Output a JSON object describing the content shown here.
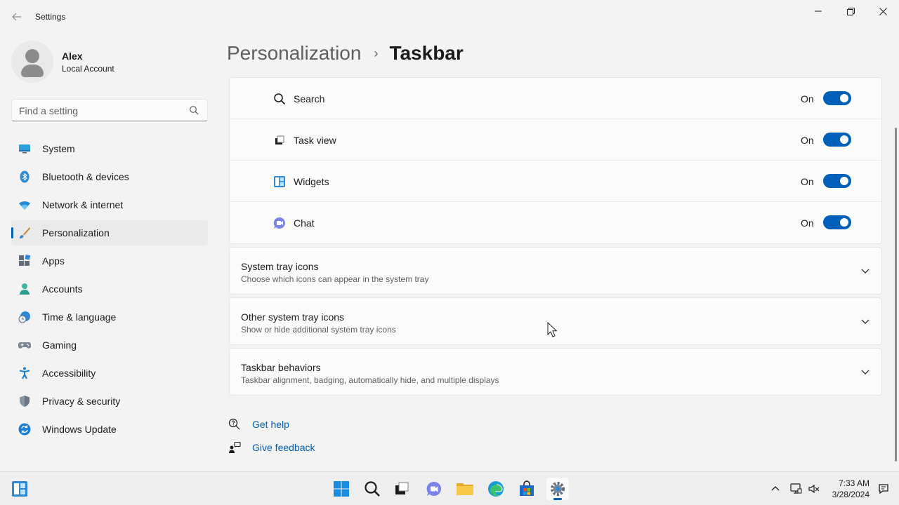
{
  "window": {
    "title": "Settings",
    "controls": {
      "minimize": "—",
      "maximize": "▢",
      "close": "✕"
    }
  },
  "profile": {
    "name": "Alex",
    "account_type": "Local Account"
  },
  "search": {
    "placeholder": "Find a setting",
    "value": ""
  },
  "sidebar": {
    "items": [
      {
        "label": "System",
        "icon": "system-icon",
        "active": false
      },
      {
        "label": "Bluetooth & devices",
        "icon": "bluetooth-icon",
        "active": false
      },
      {
        "label": "Network & internet",
        "icon": "wifi-icon",
        "active": false
      },
      {
        "label": "Personalization",
        "icon": "brush-icon",
        "active": true
      },
      {
        "label": "Apps",
        "icon": "apps-icon",
        "active": false
      },
      {
        "label": "Accounts",
        "icon": "accounts-icon",
        "active": false
      },
      {
        "label": "Time & language",
        "icon": "clock-globe-icon",
        "active": false
      },
      {
        "label": "Gaming",
        "icon": "gamepad-icon",
        "active": false
      },
      {
        "label": "Accessibility",
        "icon": "accessibility-icon",
        "active": false
      },
      {
        "label": "Privacy & security",
        "icon": "shield-icon",
        "active": false
      },
      {
        "label": "Windows Update",
        "icon": "update-icon",
        "active": false
      }
    ]
  },
  "breadcrumb": {
    "parent": "Personalization",
    "separator": "›",
    "current": "Taskbar"
  },
  "taskbar_items": {
    "rows": [
      {
        "label": "Search",
        "state": "On",
        "icon": "search-icon",
        "on": true
      },
      {
        "label": "Task view",
        "state": "On",
        "icon": "task-view-icon",
        "on": true
      },
      {
        "label": "Widgets",
        "state": "On",
        "icon": "widgets-icon",
        "on": true
      },
      {
        "label": "Chat",
        "state": "On",
        "icon": "chat-icon",
        "on": true
      }
    ]
  },
  "expanders": [
    {
      "title": "System tray icons",
      "subtitle": "Choose which icons can appear in the system tray"
    },
    {
      "title": "Other system tray icons",
      "subtitle": "Show or hide additional system tray icons"
    },
    {
      "title": "Taskbar behaviors",
      "subtitle": "Taskbar alignment, badging, automatically hide, and multiple displays"
    }
  ],
  "help": {
    "get_help": "Get help",
    "give_feedback": "Give feedback"
  },
  "system_taskbar": {
    "time": "7:33 AM",
    "date": "3/28/2024"
  },
  "colors": {
    "accent": "#005fb8",
    "background": "#f3f3f3",
    "card": "#fbfbfb"
  }
}
